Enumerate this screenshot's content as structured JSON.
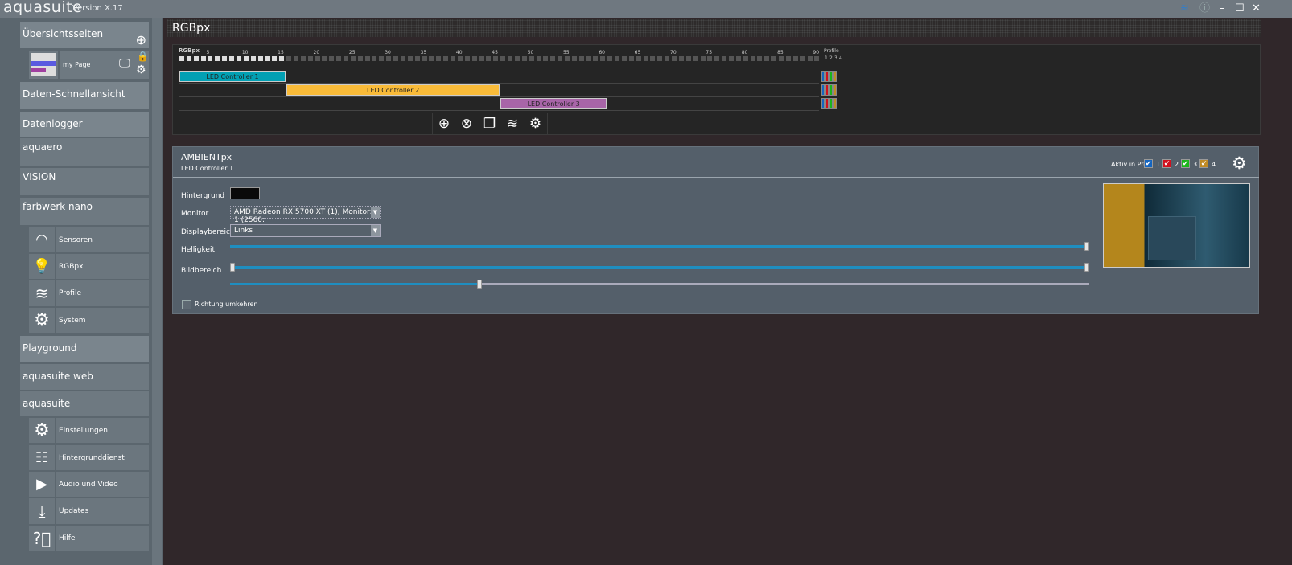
{
  "app": {
    "name": "aquasuite",
    "version": "Version X.17"
  },
  "window": {
    "layers": "≋",
    "info": "ⓘ",
    "minimize": "–",
    "maximize": "☐",
    "close": "✕"
  },
  "sidebar": {
    "overview": "Übersichtsseiten",
    "my_page": "my Page",
    "items": [
      "Daten-Schnellansicht",
      "Datenlogger",
      "aquaero",
      "VISION",
      "farbwerk nano"
    ],
    "farbwerk_sub": [
      "Sensoren",
      "RGBpx",
      "Profile",
      "System"
    ],
    "items2": [
      "Playground",
      "aquasuite web",
      "aquasuite"
    ],
    "aquasuite_sub": [
      "Einstellungen",
      "Hintergrunddienst",
      "Audio und Video",
      "Updates",
      "Hilfe"
    ]
  },
  "page_title": "RGBpx",
  "timeline": {
    "label": "RGBpx",
    "ticks": [
      "5",
      "10",
      "15",
      "20",
      "25",
      "30",
      "35",
      "40",
      "45",
      "50",
      "55",
      "60",
      "65",
      "70",
      "75",
      "80",
      "85",
      "90"
    ],
    "total_leds": 90,
    "profile_label": "Profile",
    "profile_numbers": [
      "1",
      "2",
      "3",
      "4"
    ],
    "profile_colors": [
      "#1565c0",
      "#d0101e",
      "#1bb51b",
      "#c08a24"
    ],
    "controllers": [
      {
        "name": "LED Controller 1",
        "start": 1,
        "end": 15,
        "color": "#02a0b3"
      },
      {
        "name": "LED Controller 2",
        "start": 16,
        "end": 45,
        "color": "#f9bb39"
      },
      {
        "name": "LED Controller 3",
        "start": 46,
        "end": 60,
        "color": "#a865a8"
      }
    ],
    "selected_end": 15
  },
  "ambient": {
    "title": "AMBIENTpx",
    "subtitle": "LED Controller 1",
    "active_label": "Aktiv in Profil",
    "profiles": [
      "1",
      "2",
      "3",
      "4"
    ],
    "background_label": "Hintergrund",
    "background_color": "#0a0a0a",
    "monitor_label": "Monitor",
    "monitor_value": "AMD Radeon RX 5700 XT (1), Monitor: 1 (2560:",
    "display_label": "Displaybereich",
    "display_value": "Links",
    "brightness_label": "Helligkeit",
    "brightness_percent": 100,
    "area_label": "Bildbereich",
    "area_range_percent": [
      0,
      100
    ],
    "area_second_percent": 29,
    "reverse_label": "Richtung umkehren",
    "reverse_checked": false
  }
}
